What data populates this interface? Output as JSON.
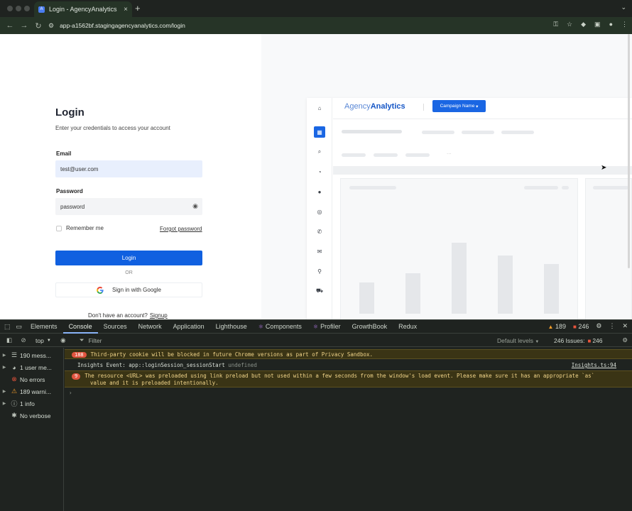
{
  "browser": {
    "tab_title": "Login - AgencyAnalytics",
    "url": "app-a1562bf.stagingagencyanalytics.com/login"
  },
  "login": {
    "title": "Login",
    "subtitle": "Enter your credentials to access your account",
    "email_label": "Email",
    "email_value": "test@user.com",
    "password_label": "Password",
    "password_value": "password",
    "remember_label": "Remember me",
    "forgot_label": "Forgot password",
    "login_button": "Login",
    "or_text": "OR",
    "google_button": "Sign in with Google",
    "no_account_text": "Don't have an account?",
    "signup_label": "Signup"
  },
  "preview": {
    "logo_light": "Agency",
    "logo_bold": "Analytics",
    "campaign_button": "Campaign Name",
    "ellipsis": "..."
  },
  "devtools": {
    "tabs": [
      "Elements",
      "Console",
      "Sources",
      "Network",
      "Application",
      "Lighthouse",
      "Components",
      "Profiler",
      "GrowthBook",
      "Redux"
    ],
    "active_tab": "Console",
    "warning_count": "189",
    "error_count": "246",
    "toolbar": {
      "context": "top",
      "filter_placeholder": "Filter",
      "levels": "Default levels",
      "issues_label": "246 Issues:",
      "issues_count": "246"
    },
    "sidebar": [
      {
        "label": "190 mess...",
        "icon": "list-icon"
      },
      {
        "label": "1 user me...",
        "icon": "user-icon"
      },
      {
        "label": "No errors",
        "icon": "error-icon"
      },
      {
        "label": "189 warni...",
        "icon": "warning-icon"
      },
      {
        "label": "1 info",
        "icon": "info-icon"
      },
      {
        "label": "No verbose",
        "icon": "bug-icon"
      }
    ],
    "messages": [
      {
        "count": "188",
        "text": "Third-party cookie will be blocked in future Chrome versions as part of Privacy Sandbox."
      },
      {
        "text": "Insights Event: app::loginSession_sessionStart",
        "extra": "undefined",
        "source": "Insights.ts:94"
      },
      {
        "count": "9",
        "text": "The resource <URL> was preloaded using link preload but not used within a few seconds from the window's load event. Please make sure it has an appropriate `as`",
        "text2": "value and it is preloaded intentionally."
      }
    ],
    "prompt": "›"
  },
  "colors": {
    "brand_blue": "#1060e0",
    "devtools_bg": "#1f2320",
    "warning_bg": "#3a3415"
  }
}
